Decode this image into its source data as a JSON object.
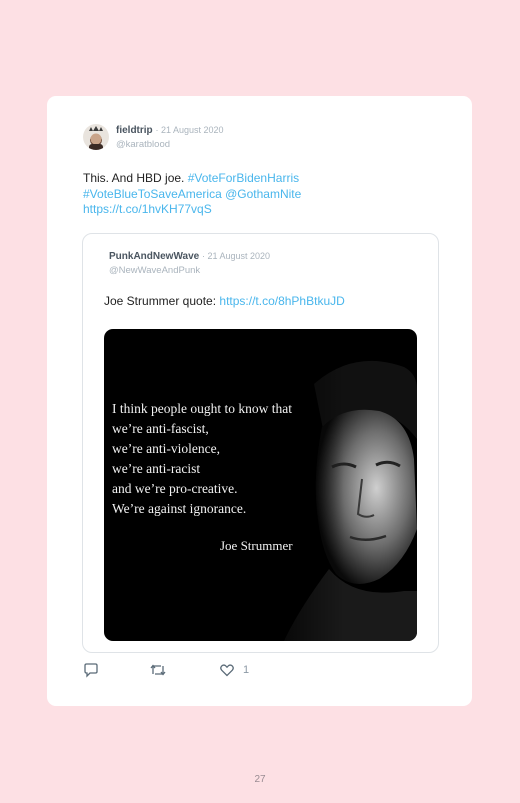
{
  "tweet": {
    "author_name": "fieldtrip",
    "date": "· 21 August 2020",
    "handle": "@karatblood",
    "text_plain": "This. And HBD joe. ",
    "hashtag_1": "#VoteForBidenHarris",
    "hashtag_2": "#VoteBlueToSaveAmerica",
    "mention": "@GothamNite",
    "link": "https://t.co/1hvKH77vqS",
    "like_count": "1"
  },
  "quoted_tweet": {
    "author_name": "PunkAndNewWave",
    "date": "· 21 August 2020",
    "handle": "@NewWaveAndPunk",
    "text_plain": "Joe Strummer quote: ",
    "link": "https://t.co/8hPhBtkuJD",
    "image": {
      "lines": [
        "I think people ought to know that",
        "we’re anti-fascist,",
        "we’re anti-violence,",
        "we’re anti-racist",
        "and we’re pro-creative.",
        "We’re against ignorance."
      ],
      "attribution": "Joe Strummer"
    }
  },
  "actions": {
    "reply_icon": "reply-icon",
    "retweet_icon": "retweet-icon",
    "like_icon": "heart-icon"
  },
  "colors": {
    "page_background": "#fde0e4",
    "link": "#49b6ec",
    "muted": "#aab4bd"
  },
  "page_number": "27"
}
